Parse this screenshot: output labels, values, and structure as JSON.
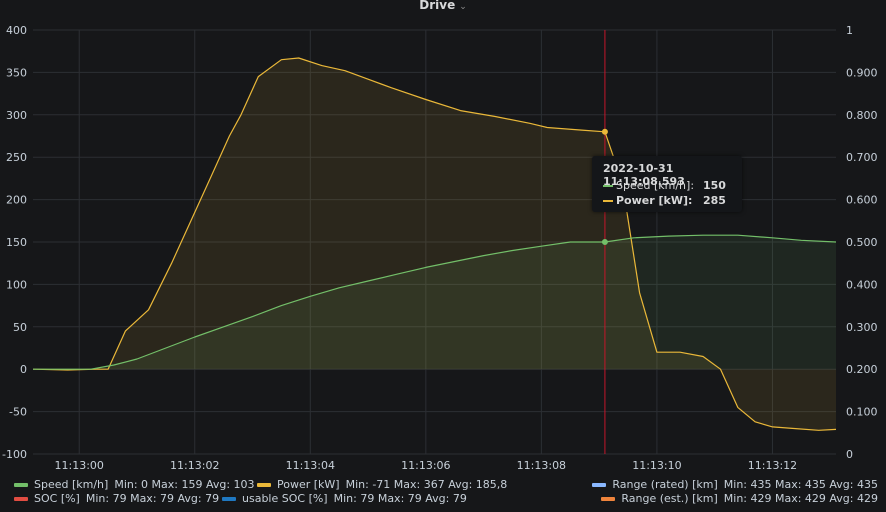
{
  "panel": {
    "title": "Drive"
  },
  "chart_data": {
    "type": "line",
    "x_ticks": [
      "11:13:00",
      "11:13:02",
      "11:13:04",
      "11:13:06",
      "11:13:08",
      "11:13:10",
      "11:13:12"
    ],
    "x_tick_seconds": [
      0,
      2,
      4,
      6,
      8,
      10,
      12
    ],
    "xlim_seconds": [
      -0.8,
      13.1
    ],
    "y_left": {
      "ylim": [
        -100,
        400
      ],
      "ticks": [
        "400",
        "350",
        "300",
        "250",
        "200",
        "150",
        "100",
        "50",
        "0",
        "-50",
        "-100"
      ],
      "tick_values": [
        400,
        350,
        300,
        250,
        200,
        150,
        100,
        50,
        0,
        -50,
        -100
      ]
    },
    "y_right": {
      "ylim": [
        0,
        1
      ],
      "ticks": [
        "1",
        "0.900",
        "0.800",
        "0.700",
        "0.600",
        "0.500",
        "0.400",
        "0.300",
        "0.200",
        "0.100",
        "0"
      ],
      "tick_values": [
        1,
        0.9,
        0.8,
        0.7,
        0.6,
        0.5,
        0.4,
        0.3,
        0.2,
        0.1,
        0
      ]
    },
    "grid": true,
    "cursor_seconds": 9.1,
    "series": [
      {
        "name": "Power [kW]",
        "color": "#eab839",
        "fill": true,
        "x": [
          -0.8,
          -0.2,
          0.3,
          0.5,
          0.8,
          1.2,
          1.6,
          2.0,
          2.3,
          2.6,
          2.8,
          3.1,
          3.5,
          3.8,
          4.2,
          4.6,
          5.0,
          5.4,
          6.0,
          6.6,
          7.2,
          7.8,
          8.1,
          8.7,
          9.1,
          9.4,
          9.7,
          10.0,
          10.4,
          10.8,
          11.1,
          11.4,
          11.7,
          12.0,
          12.4,
          12.8,
          13.1
        ],
        "y": [
          0,
          -1,
          0,
          0,
          45,
          70,
          125,
          185,
          230,
          275,
          300,
          345,
          365,
          367,
          358,
          352,
          342,
          332,
          318,
          305,
          298,
          290,
          285,
          282,
          280,
          220,
          90,
          20,
          20,
          15,
          0,
          -45,
          -62,
          -68,
          -70,
          -72,
          -71
        ]
      },
      {
        "name": "Speed [km/h]",
        "color": "#73bf69",
        "fill": true,
        "x": [
          -0.8,
          0.2,
          0.6,
          1.0,
          1.5,
          2.0,
          2.5,
          3.0,
          3.5,
          4.0,
          4.5,
          5.0,
          5.5,
          6.0,
          6.5,
          7.0,
          7.5,
          8.0,
          8.5,
          9.1,
          9.6,
          10.2,
          10.8,
          11.4,
          12.0,
          12.5,
          13.1
        ],
        "y": [
          0,
          0,
          5,
          12,
          25,
          38,
          50,
          62,
          75,
          86,
          96,
          104,
          112,
          120,
          127,
          134,
          140,
          145,
          150,
          150,
          155,
          157,
          158,
          158,
          155,
          152,
          150
        ]
      }
    ],
    "legend": [
      {
        "name": "Speed [km/h]",
        "color": "#73bf69",
        "stats": "Min: 0   Max: 159   Avg: 103"
      },
      {
        "name": "Power [kW]",
        "color": "#eab839",
        "stats": "Min: -71   Max: 367   Avg: 185,8"
      },
      {
        "name": "Range (rated) [km]",
        "color": "#8ab8ff",
        "stats": "Min: 435   Max: 435   Avg: 435"
      },
      {
        "name": "SOC [%]",
        "color": "#e24d42",
        "stats": "Min: 79   Max: 79   Avg: 79"
      },
      {
        "name": "usable SOC [%]",
        "color": "#1f78c1",
        "stats": "Min: 79   Max: 79   Avg: 79"
      },
      {
        "name": "Range (est.) [km]",
        "color": "#ef843c",
        "stats": "Min: 429   Max: 429   Avg: 429"
      }
    ]
  },
  "tooltip": {
    "time": "2022-10-31 11:13:08.593",
    "rows": [
      {
        "label": "Speed [km/h]:",
        "value": "150",
        "color": "#73bf69",
        "bold": false
      },
      {
        "label": "Power [kW]:",
        "value": "285",
        "color": "#eab839",
        "bold": true
      }
    ]
  }
}
